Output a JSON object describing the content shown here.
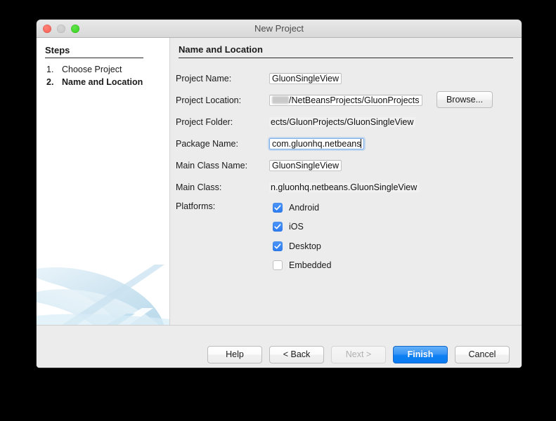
{
  "window": {
    "title": "New Project",
    "traffic_lights": [
      "close",
      "minimize",
      "maximize"
    ]
  },
  "sidebar": {
    "heading": "Steps",
    "steps": [
      {
        "num": "1.",
        "label": "Choose Project",
        "current": false
      },
      {
        "num": "2.",
        "label": "Name and Location",
        "current": true
      }
    ]
  },
  "main": {
    "heading": "Name and Location",
    "fields": [
      {
        "label": "Project Name:",
        "value": "GluonSingleView",
        "state": "normal",
        "redacted": false
      },
      {
        "label": "Project Location:",
        "value": "/NetBeansProjects/GluonProjects",
        "state": "normal",
        "redacted": true
      },
      {
        "label": "Project Folder:",
        "value": "ects/GluonProjects/GluonSingleView",
        "state": "readonly",
        "redacted": false
      },
      {
        "label": "Package Name:",
        "value": "com.gluonhq.netbeans",
        "state": "focused",
        "redacted": false
      },
      {
        "label": "Main Class Name:",
        "value": "GluonSingleView",
        "state": "normal",
        "redacted": false
      },
      {
        "label": "Main Class:",
        "value": "n.gluonhq.netbeans.GluonSingleView",
        "state": "readonly",
        "redacted": false
      }
    ],
    "browse_label": "Browse...",
    "platforms_label": "Platforms:",
    "platforms": [
      {
        "label": "Android",
        "checked": true
      },
      {
        "label": "iOS",
        "checked": true
      },
      {
        "label": "Desktop",
        "checked": true
      },
      {
        "label": "Embedded",
        "checked": false
      }
    ]
  },
  "buttons": {
    "help": {
      "label": "Help",
      "state": "normal"
    },
    "back": {
      "label": "< Back",
      "state": "normal"
    },
    "next": {
      "label": "Next >",
      "state": "disabled"
    },
    "finish": {
      "label": "Finish",
      "state": "primary"
    },
    "cancel": {
      "label": "Cancel",
      "state": "normal"
    }
  },
  "colors": {
    "accent_blue": "#3a95f6",
    "checkbox_blue": "#2c7bf2",
    "window_bg": "#ececec",
    "sidebar_bg": "#ffffff",
    "swoosh": "#bfdcec"
  }
}
